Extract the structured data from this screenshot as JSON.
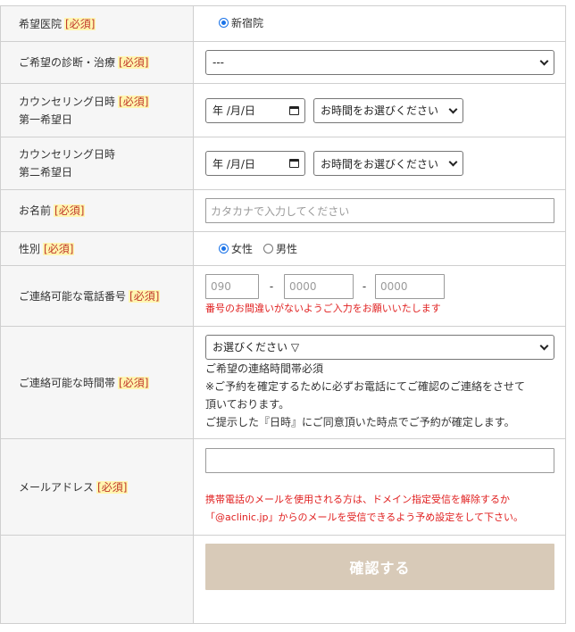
{
  "required_mark": "[必須]",
  "clinic": {
    "label": "希望医院",
    "option": "新宿院"
  },
  "treatment": {
    "label": "ご希望の診断・治療",
    "value": "---"
  },
  "counsel1": {
    "label": "カウンセリング日時",
    "sub": "第一希望日",
    "date": "年 /月/日",
    "time": "お時間をお選びください"
  },
  "counsel2": {
    "label": "カウンセリング日時",
    "sub": "第二希望日",
    "date": "年 /月/日",
    "time": "お時間をお選びください"
  },
  "name": {
    "label": "お名前",
    "placeholder": "カタカナで入力してください"
  },
  "gender": {
    "label": "性別",
    "female": "女性",
    "male": "男性"
  },
  "phone": {
    "label": "ご連絡可能な電話番号",
    "p1": "090",
    "p2": "0000",
    "p3": "0000",
    "dash": "-",
    "note": "番号のお間違いがないようご入力をお願いいたします"
  },
  "contact_time": {
    "label": "ご連絡可能な時間帯",
    "value": "お選びください ▽",
    "note1": "ご希望の連絡時間帯必須",
    "note2": "※ご予約を確定するために必ずお電話にてご確認のご連絡をさせて",
    "note3": "頂いております。",
    "note4": "ご提示した『日時』にご同意頂いた時点でご予約が確定します。"
  },
  "email": {
    "label": "メールアドレス",
    "note1": "携帯電話のメールを使用される方は、ドメイン指定受信を解除するか",
    "note2": "「@aclinic.jp」からのメールを受信できるよう予め設定をして下さい。"
  },
  "submit": {
    "label": "確認する"
  }
}
